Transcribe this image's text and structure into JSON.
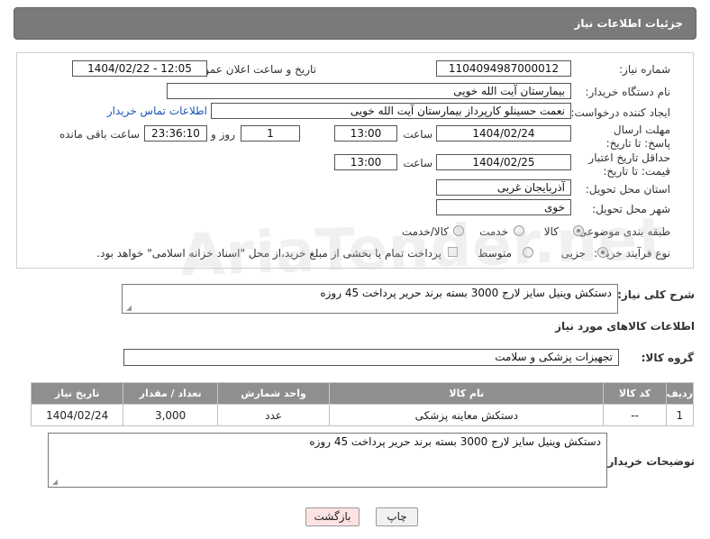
{
  "header": {
    "title": "جزئیات اطلاعات نیاز"
  },
  "form": {
    "need_number_label": "شماره نیاز:",
    "need_number": "1104094987000012",
    "announce_label": "تاریخ و ساعت اعلان عمومی:",
    "announce_value": "1404/02/22 - 12:05",
    "buyer_org_label": "نام دستگاه خریدار:",
    "buyer_org": "بیمارستان آیت الله خویی",
    "creator_label": "ایجاد کننده درخواست:",
    "creator": "نعمت حسینلو کارپرداز بیمارستان آیت الله خویی",
    "contact_link": "اطلاعات تماس خریدار",
    "deadline_label": "مهلت ارسال پاسخ: تا تاریخ:",
    "deadline_date": "1404/02/24",
    "time_label": "ساعت",
    "deadline_time": "13:00",
    "days_value": "1",
    "days_label": "روز و",
    "remaining_time": "23:36:10",
    "remaining_label": "ساعت باقی مانده",
    "validity_label": "حداقل تاریخ اعتبار قیمت: تا تاریخ:",
    "validity_date": "1404/02/25",
    "validity_time_label": "ساعت",
    "validity_time": "13:00",
    "province_label": "استان محل تحویل:",
    "province": "آذربایجان غربی",
    "city_label": "شهر محل تحویل:",
    "city": "خوی",
    "category_label": "طبقه بندی موضوعی:",
    "category_options": [
      "کالا",
      "خدمت",
      "کالا/خدمت"
    ],
    "process_label": "نوع فرآیند خرید :",
    "process_options": [
      "جزیی",
      "متوسط"
    ],
    "payment_note": "پرداخت تمام یا بخشی از مبلغ خرید،از محل \"اسناد خزانه اسلامی\" خواهد بود."
  },
  "description": {
    "label": "شرح کلی نیاز:",
    "text": "دستکش وینیل سایز لارج 3000 بسته برند حریر پرداخت 45 روزه"
  },
  "goods": {
    "section_title": "اطلاعات کالاهای مورد نیاز",
    "group_label": "گروه کالا:",
    "group_value": "تجهیزات پزشکی و سلامت",
    "columns": [
      "ردیف",
      "کد کالا",
      "نام کالا",
      "واحد شمارش",
      "تعداد / مقدار",
      "تاریخ نیاز"
    ],
    "rows": [
      {
        "index": "1",
        "code": "--",
        "name": "دستکش معاینه پزشکی",
        "unit": "عدد",
        "qty": "3,000",
        "date": "1404/02/24"
      }
    ]
  },
  "buyer_notes": {
    "label": "توضیحات خریدار:",
    "text": "دستکش وینیل سایز لارج 3000 بسته برند حریر پرداخت 45 روزه"
  },
  "buttons": {
    "print": "چاپ",
    "back": "بازگشت"
  },
  "colors": {
    "header_bg": "#7a7a7a",
    "link": "#1a55b5",
    "back_button_bg": "#fde3e3"
  }
}
